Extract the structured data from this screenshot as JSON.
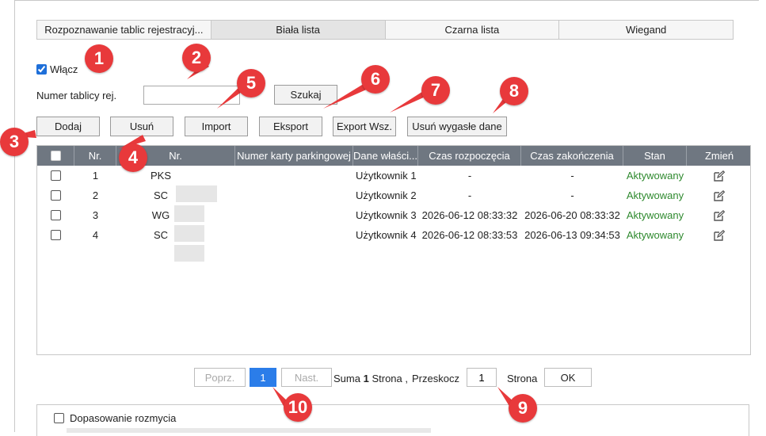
{
  "tabs": [
    {
      "label": "Rozpoznawanie tablic rejestracyj...",
      "active": false
    },
    {
      "label": "Biała lista",
      "active": true
    },
    {
      "label": "Czarna lista",
      "active": false
    },
    {
      "label": "Wiegand",
      "active": false
    }
  ],
  "enable": {
    "label": "Włącz",
    "checked": true
  },
  "search": {
    "plate_label": "Numer tablicy rej.",
    "plate_value": "",
    "search_button": "Szukaj"
  },
  "toolbar": {
    "add": "Dodaj",
    "delete": "Usuń",
    "import": "Import",
    "export": "Eksport",
    "export_all": "Export Wsz.",
    "delete_expired": "Usuń wygasłe dane"
  },
  "table": {
    "headers": [
      "",
      "Nr.",
      "Nr.",
      "Numer karty parkingowej",
      "Dane właści...",
      "Czas rozpoczęcia",
      "Czas zakończenia",
      "Stan",
      "Zmień"
    ],
    "rows": [
      {
        "no": "1",
        "plate": "PKS",
        "card": "",
        "owner": "Użytkownik 1",
        "start": "-",
        "end": "-",
        "status": "Aktywowany"
      },
      {
        "no": "2",
        "plate": "SC",
        "card": "",
        "owner": "Użytkownik 2",
        "start": "-",
        "end": "-",
        "status": "Aktywowany"
      },
      {
        "no": "3",
        "plate": "WG",
        "card": "",
        "owner": "Użytkownik 3",
        "start": "2026-06-12 08:33:32",
        "end": "2026-06-20 08:33:32",
        "status": "Aktywowany"
      },
      {
        "no": "4",
        "plate": "SC",
        "card": "",
        "owner": "Użytkownik 4",
        "start": "2026-06-12 08:33:53",
        "end": "2026-06-13 09:34:53",
        "status": "Aktywowany"
      }
    ]
  },
  "pager": {
    "prev": "Poprz.",
    "current": "1",
    "next": "Nast.",
    "total_label": "Suma",
    "total_value": "1",
    "strona_label": "Strona ,",
    "jump_label": "Przeskocz",
    "jump_value": "1",
    "page_label": "Strona",
    "ok": "OK"
  },
  "fuzzy": {
    "label": "Dopasowanie rozmycia",
    "checked": false
  },
  "annotations": [
    "1",
    "2",
    "3",
    "4",
    "5",
    "6",
    "7",
    "8",
    "9",
    "10"
  ],
  "colors": {
    "header_bg": "#6f7781",
    "status_active": "#2f8a2f",
    "accent": "#2b7de9",
    "annotation": "#e8393b"
  }
}
